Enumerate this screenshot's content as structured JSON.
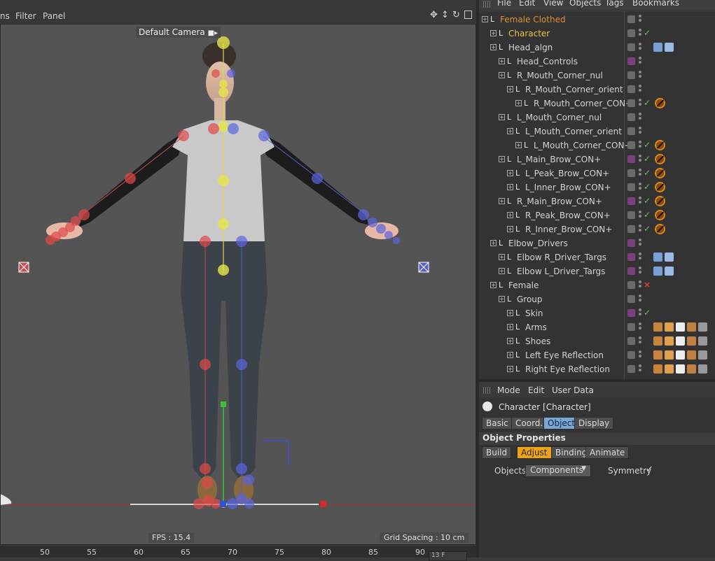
{
  "viewport": {
    "menu": [
      "ns",
      "Filter",
      "Panel"
    ],
    "camera_label": "Default Camera",
    "fps": "FPS : 15.4",
    "grid_spacing": "Grid Spacing : 10 cm",
    "ruler_ticks": [
      "50",
      "55",
      "60",
      "65",
      "70",
      "75",
      "80",
      "85",
      "90"
    ],
    "frame_value": "13 F"
  },
  "object_manager": {
    "menu": [
      "File",
      "Edit",
      "View",
      "Objects",
      "Tags",
      "Bookmarks"
    ],
    "items": [
      {
        "label": "Female Clothed",
        "depth": 0,
        "highlight": true,
        "flag": "normal",
        "check": "",
        "tag": ""
      },
      {
        "label": "Character",
        "depth": 1,
        "highlight": true,
        "flag": "normal",
        "check": "check",
        "tag": ""
      },
      {
        "label": "Head_algn",
        "depth": 1,
        "highlight": false,
        "flag": "normal",
        "check": "",
        "tag": "ik"
      },
      {
        "label": "Head_Controls",
        "depth": 2,
        "highlight": false,
        "flag": "purple",
        "check": "",
        "tag": ""
      },
      {
        "label": "R_Mouth_Corner_nul",
        "depth": 2,
        "highlight": false,
        "flag": "normal",
        "check": "",
        "tag": ""
      },
      {
        "label": "R_Mouth_Corner_orient",
        "depth": 3,
        "highlight": false,
        "flag": "normal",
        "check": "",
        "tag": ""
      },
      {
        "label": "R_Mouth_Corner_CON+",
        "depth": 4,
        "highlight": false,
        "flag": "normal",
        "check": "check",
        "tag": "no"
      },
      {
        "label": "L_Mouth_Corner_nul",
        "depth": 2,
        "highlight": false,
        "flag": "normal",
        "check": "",
        "tag": ""
      },
      {
        "label": "L_Mouth_Corner_orient",
        "depth": 3,
        "highlight": false,
        "flag": "normal",
        "check": "",
        "tag": ""
      },
      {
        "label": "L_Mouth_Corner_CON+",
        "depth": 4,
        "highlight": false,
        "flag": "normal",
        "check": "check",
        "tag": "no"
      },
      {
        "label": "L_Main_Brow_CON+",
        "depth": 2,
        "highlight": false,
        "flag": "purple",
        "check": "check",
        "tag": "no"
      },
      {
        "label": "L_Peak_Brow_CON+",
        "depth": 3,
        "highlight": false,
        "flag": "normal",
        "check": "check",
        "tag": "no"
      },
      {
        "label": "L_Inner_Brow_CON+",
        "depth": 3,
        "highlight": false,
        "flag": "normal",
        "check": "check",
        "tag": "no"
      },
      {
        "label": "R_Main_Brow_CON+",
        "depth": 2,
        "highlight": false,
        "flag": "purple",
        "check": "check",
        "tag": "no"
      },
      {
        "label": "R_Peak_Brow_CON+",
        "depth": 3,
        "highlight": false,
        "flag": "normal",
        "check": "check",
        "tag": "no"
      },
      {
        "label": "R_Inner_Brow_CON+",
        "depth": 3,
        "highlight": false,
        "flag": "normal",
        "check": "check",
        "tag": "no"
      },
      {
        "label": "Elbow_Drivers",
        "depth": 1,
        "highlight": false,
        "flag": "purple",
        "check": "",
        "tag": ""
      },
      {
        "label": "Elbow R_Driver_Targs",
        "depth": 2,
        "highlight": false,
        "flag": "purple",
        "check": "",
        "tag": "driver"
      },
      {
        "label": "Elbow L_Driver_Targs",
        "depth": 2,
        "highlight": false,
        "flag": "purple",
        "check": "",
        "tag": "driver"
      },
      {
        "label": "Female",
        "depth": 1,
        "highlight": false,
        "flag": "normal",
        "check": "x",
        "tag": ""
      },
      {
        "label": "Group",
        "depth": 2,
        "highlight": false,
        "flag": "normal",
        "check": "",
        "tag": ""
      },
      {
        "label": "Skin",
        "depth": 3,
        "highlight": false,
        "flag": "purple",
        "check": "check",
        "tag": ""
      },
      {
        "label": "Arms",
        "depth": 3,
        "highlight": false,
        "flag": "normal",
        "check": "",
        "tag": "multi"
      },
      {
        "label": "Shoes",
        "depth": 3,
        "highlight": false,
        "flag": "normal",
        "check": "",
        "tag": "multi"
      },
      {
        "label": "Left Eye Reflection",
        "depth": 3,
        "highlight": false,
        "flag": "normal",
        "check": "",
        "tag": "multi"
      },
      {
        "label": "Right Eye Reflection",
        "depth": 3,
        "highlight": false,
        "flag": "normal",
        "check": "",
        "tag": "multi"
      }
    ]
  },
  "attribute_manager": {
    "menu": [
      "Mode",
      "Edit",
      "User Data"
    ],
    "object_title": "Character [Character]",
    "tabs": [
      "Basic",
      "Coord.",
      "Object",
      "Display"
    ],
    "active_tab": "Object",
    "section_title": "Object Properties",
    "subtabs": [
      "Build",
      "Adjust",
      "Binding",
      "Animate"
    ],
    "active_subtab": "Adjust",
    "objects_label": "Objects",
    "objects_value": "Components",
    "symmetry_label": "Symmetry",
    "symmetry_checked": true
  }
}
